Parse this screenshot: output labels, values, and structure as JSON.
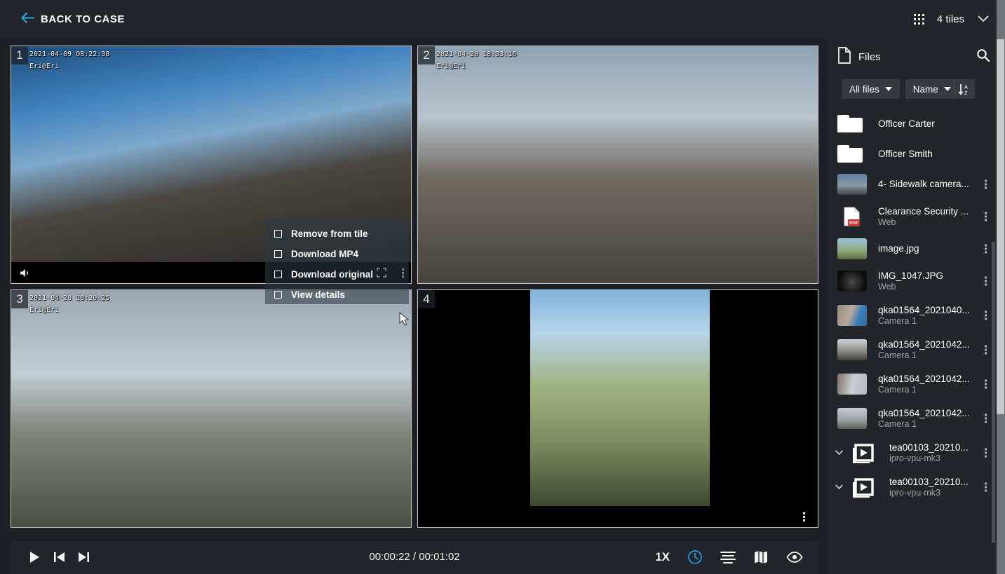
{
  "topbar": {
    "back_label": "BACK TO CASE",
    "back_icon": "arrow-left-icon",
    "grid_icon": "grid-apps-icon",
    "tiles_label": "4 tiles",
    "chevron_icon": "chevron-down-icon"
  },
  "accent_color": "#2ba7dd",
  "panel_color": "#22262a",
  "stage_color": "#1d2125",
  "tiles": [
    {
      "number": "1",
      "timestamp": "2021-04-09 08:22:38",
      "channel": "Eri@Eri",
      "volume_icon": "volume-icon",
      "fullscreen_icon": "fullscreen-icon",
      "kebab_icon": "more-vertical-icon"
    },
    {
      "number": "2",
      "timestamp": "2021-04-20 18:33:16",
      "channel": "Eri@Eri"
    },
    {
      "number": "3",
      "timestamp": "2021-04-20 18:20:25",
      "channel": "Eri@Eri"
    },
    {
      "number": "4",
      "timestamp": "",
      "channel": "",
      "kebab_icon": "more-vertical-icon"
    }
  ],
  "context_menu": {
    "items": [
      {
        "label": "Remove from tile",
        "icon": "checkbox-icon"
      },
      {
        "label": "Download MP4",
        "icon": "checkbox-icon"
      },
      {
        "label": "Download original",
        "icon": "checkbox-icon"
      },
      {
        "label": "View details",
        "icon": "checkbox-icon"
      }
    ]
  },
  "transport": {
    "play_icon": "play-icon",
    "prev_icon": "skip-previous-icon",
    "next_icon": "skip-next-icon",
    "current_time": "00:00:22",
    "total_time": "00:01:02",
    "time_display": "00:00:22 / 00:01:02",
    "speed_label": "1X",
    "clock_icon": "clock-icon",
    "clock_active_color": "#1b9dd9",
    "list_icon": "align-list-icon",
    "map_icon": "map-icon",
    "eye_icon": "eye-icon"
  },
  "files": {
    "title": "Files",
    "file_icon": "document-icon",
    "search_icon": "search-icon",
    "filter_label": "All files",
    "sort_field_label": "Name",
    "sort_direction_icon": "sort-a-z-icon",
    "items": [
      {
        "name": "Officer Carter",
        "sub": "",
        "icon": "folder-icon",
        "expandable": false
      },
      {
        "name": "Officer Smith",
        "sub": "",
        "icon": "folder-icon",
        "expandable": false
      },
      {
        "name": "4- Sidewalk camera...",
        "sub": "",
        "icon": "image-thumb",
        "expandable": false
      },
      {
        "name": "Clearance Security ...",
        "sub": "Web",
        "icon": "pdf-icon",
        "expandable": false
      },
      {
        "name": "image.jpg",
        "sub": "",
        "icon": "image-thumb",
        "expandable": false
      },
      {
        "name": "IMG_1047.JPG",
        "sub": "Web",
        "icon": "image-thumb",
        "expandable": false
      },
      {
        "name": "qka01564_2021040...",
        "sub": "Camera 1",
        "icon": "image-thumb",
        "expandable": false
      },
      {
        "name": "qka01564_2021042...",
        "sub": "Camera 1",
        "icon": "image-thumb",
        "expandable": false
      },
      {
        "name": "qka01564_2021042...",
        "sub": "Camera 1",
        "icon": "image-thumb",
        "expandable": false
      },
      {
        "name": "qka01564_2021042...",
        "sub": "Camera 1",
        "icon": "image-thumb",
        "expandable": false
      },
      {
        "name": "tea00103_20210...",
        "sub": "ipro-vpu-mk3",
        "icon": "video-stack-icon",
        "expandable": true
      },
      {
        "name": "tea00103_20210...",
        "sub": "ipro-vpu-mk3",
        "icon": "video-stack-icon",
        "expandable": true
      }
    ]
  }
}
